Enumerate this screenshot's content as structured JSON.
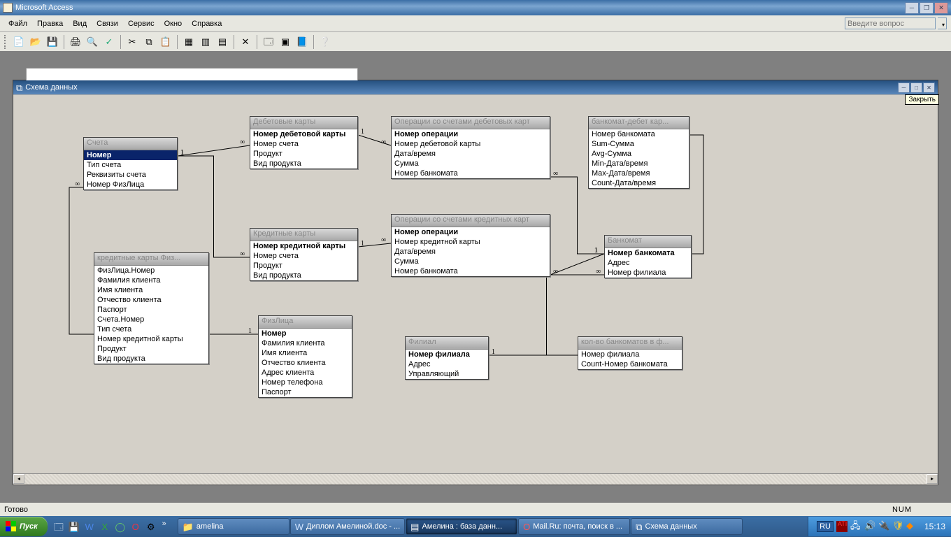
{
  "app": {
    "title": "Microsoft Access"
  },
  "menu": {
    "items": [
      "Файл",
      "Правка",
      "Вид",
      "Связи",
      "Сервис",
      "Окно",
      "Справка"
    ],
    "prompt": "Введите вопрос"
  },
  "child_window": {
    "title": "Схема данных",
    "close_tooltip": "Закрыть"
  },
  "tables": {
    "accounts": {
      "title": "Счета",
      "fields": [
        "Номер",
        "Тип счета",
        "Реквизиты счета",
        "Номер ФизЛица"
      ],
      "pk": [
        "Номер"
      ],
      "selected": "Номер"
    },
    "debit_cards": {
      "title": "Дебетовые карты",
      "fields": [
        "Номер дебетовой карты",
        "Номер счета",
        "Продукт",
        "Вид продукта"
      ],
      "pk": [
        "Номер дебетовой карты"
      ]
    },
    "debit_ops": {
      "title": "Операции со счетами дебетовых карт",
      "fields": [
        "Номер операции",
        "Номер дебетовой карты",
        "Дата/время",
        "Сумма",
        "Номер банкомата"
      ],
      "pk": [
        "Номер операции"
      ]
    },
    "atm_debit_q": {
      "title": "банкомат-дебет кар...",
      "fields": [
        "Номер банкомата",
        "Sum-Сумма",
        "Avg-Сумма",
        "Min-Дата/время",
        "Max-Дата/время",
        "Count-Дата/время"
      ]
    },
    "credit_cards": {
      "title": "Кредитные карты",
      "fields": [
        "Номер кредитной карты",
        "Номер счета",
        "Продукт",
        "Вид продукта"
      ],
      "pk": [
        "Номер кредитной карты"
      ]
    },
    "credit_ops": {
      "title": "Операции со счетами кредитных карт",
      "fields": [
        "Номер операции",
        "Номер кредитной карты",
        "Дата/время",
        "Сумма",
        "Номер банкомата"
      ],
      "pk": [
        "Номер операции"
      ]
    },
    "atm": {
      "title": "Банкомат",
      "fields": [
        "Номер банкомата",
        "Адрес",
        "Номер филиала"
      ],
      "pk": [
        "Номер банкомата"
      ]
    },
    "cc_persons_q": {
      "title": "кредитные карты Физ...",
      "fields": [
        "ФизЛица.Номер",
        "Фамилия клиента",
        "Имя клиента",
        "Отчество клиента",
        "Паспорт",
        "Счета.Номер",
        "Тип счета",
        "Номер кредитной карты",
        "Продукт",
        "Вид продукта"
      ]
    },
    "persons": {
      "title": "ФизЛица",
      "fields": [
        "Номер",
        "Фамилия клиента",
        "Имя клиента",
        "Отчество клиента",
        "Адрес клиента",
        "Номер телефона",
        "Паспорт"
      ],
      "pk": [
        "Номер"
      ]
    },
    "branch": {
      "title": "Филиал",
      "fields": [
        "Номер филиала",
        "Адрес",
        "Управляющий"
      ],
      "pk": [
        "Номер филиала"
      ]
    },
    "atm_count_q": {
      "title": "кол-во банкоматов в ф...",
      "fields": [
        "Номер филиала",
        "Count-Номер банкомата"
      ]
    }
  },
  "relations": [
    {
      "l": "1",
      "r": "∞"
    },
    {
      "l": "1",
      "r": "∞"
    },
    {
      "l": "1",
      "r": "∞"
    },
    {
      "l": "1",
      "r": "∞"
    },
    {
      "l": "1",
      "r": "∞"
    },
    {
      "l": "1",
      "r": "∞"
    },
    {
      "l": "1",
      "r": "∞"
    }
  ],
  "status": {
    "left": "Готово",
    "right": "NUM"
  },
  "taskbar": {
    "start": "Пуск",
    "folder": "amelina",
    "tasks": [
      {
        "label": "Диплом Амелиной.doc - ..."
      },
      {
        "label": "Амелина : база данн...",
        "active": true
      },
      {
        "label": "Mail.Ru: почта, поиск в ..."
      },
      {
        "label": "Схема данных"
      }
    ],
    "lang": "RU",
    "time": "15:13"
  }
}
